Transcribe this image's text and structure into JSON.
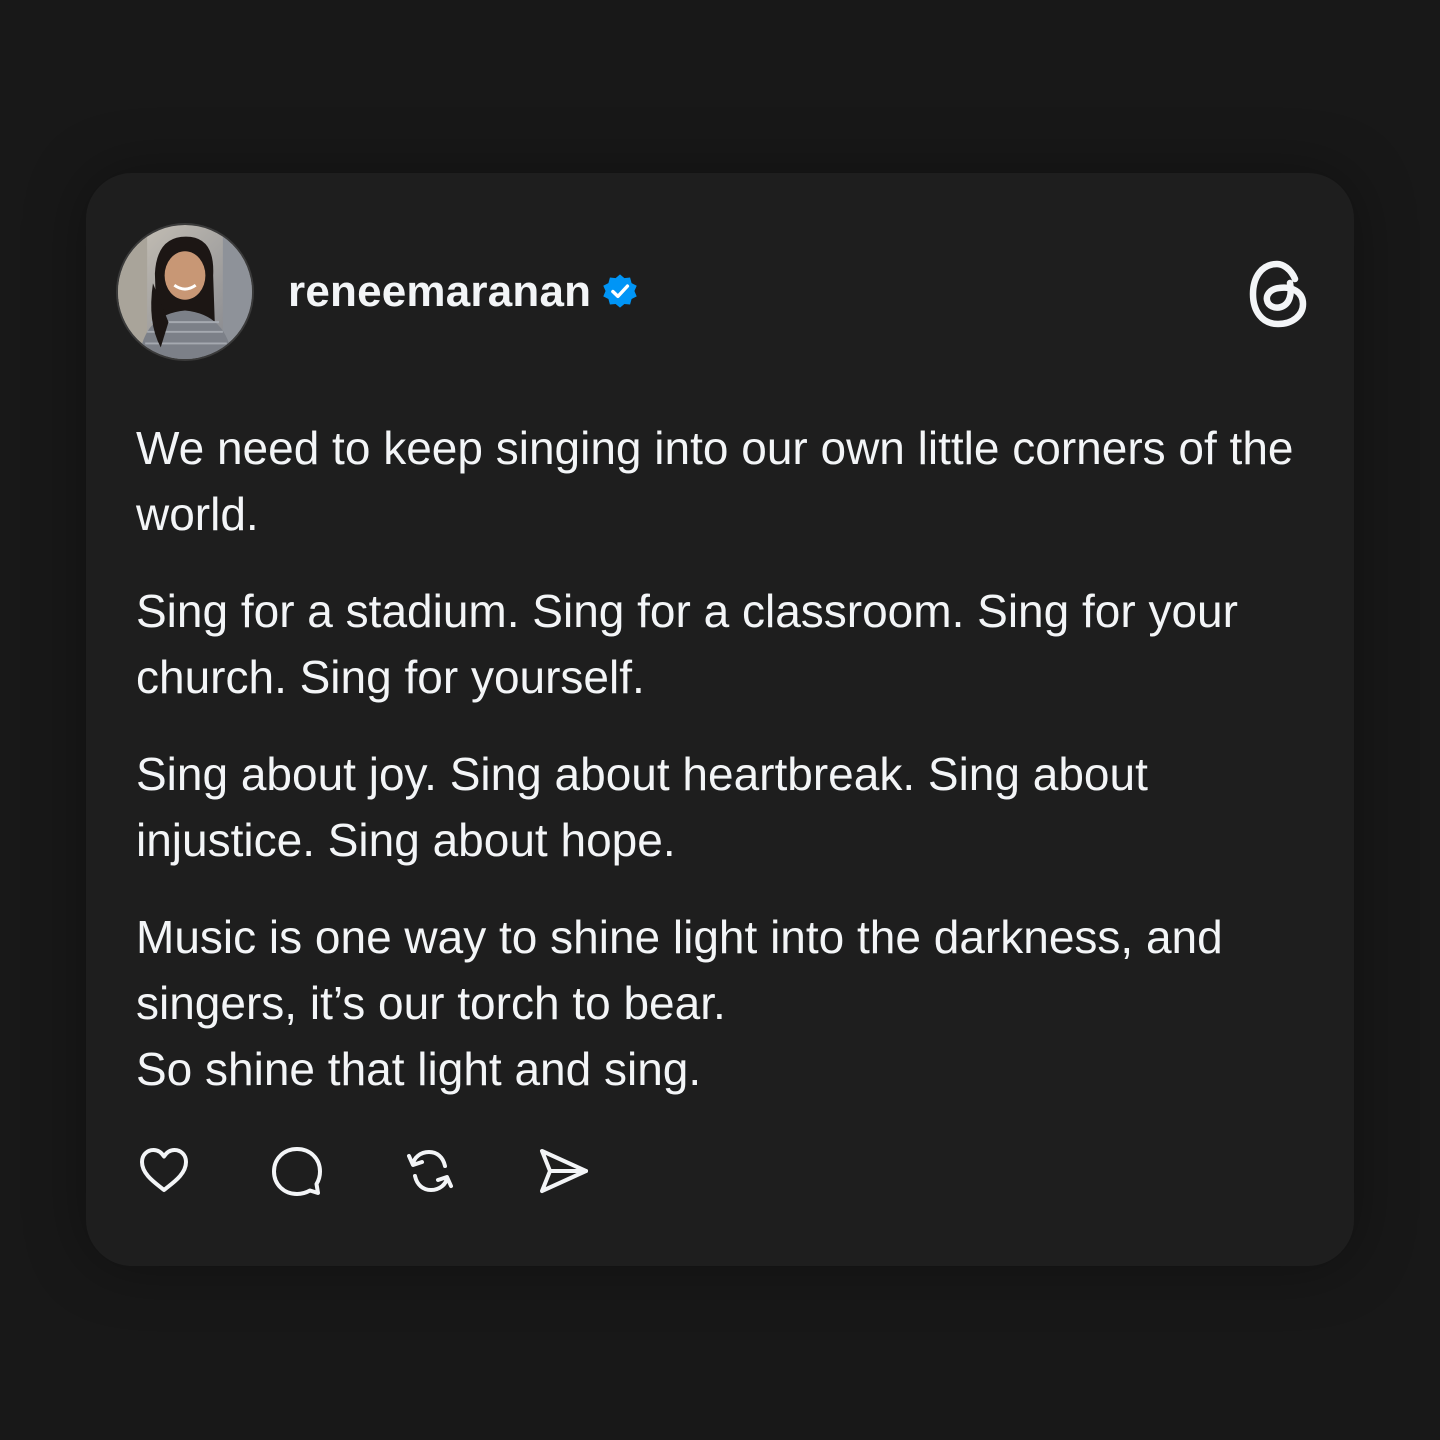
{
  "post": {
    "username": "reneemaranan",
    "verified": true,
    "avatar": {
      "description_icon": "profile-photo"
    },
    "brand_icon": "threads-logo-icon",
    "paragraphs": [
      "We need to keep singing into our own little corners of the world.",
      "Sing for a stadium. Sing for a classroom. Sing for your church. Sing for yourself.",
      "Sing about joy. Sing about heartbreak. Sing about injustice. Sing about hope.",
      "Music is one way to shine light into the darkness, and singers, it’s our torch to bear.",
      "So shine that light and sing."
    ],
    "actions": [
      {
        "icon": "heart-icon"
      },
      {
        "icon": "comment-icon"
      },
      {
        "icon": "repost-icon"
      },
      {
        "icon": "share-icon"
      }
    ]
  },
  "colors": {
    "background": "#181818",
    "card": "#1e1e1e",
    "text": "#f3f5f7",
    "verified_badge": "#0095f6"
  }
}
